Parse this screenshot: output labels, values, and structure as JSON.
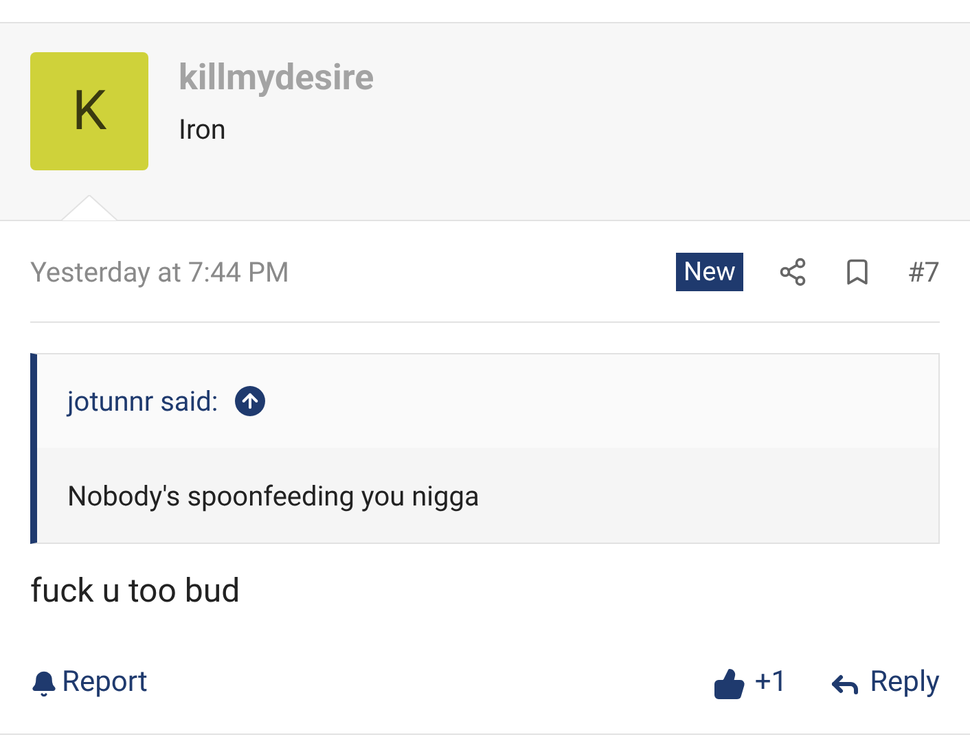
{
  "user": {
    "initial": "K",
    "name": "killmydesire",
    "title": "Iron"
  },
  "post": {
    "date": "Yesterday at 7:44 PM",
    "badge": "New",
    "number": "#7"
  },
  "quote": {
    "author": "jotunnr said:",
    "text": "Nobody's spoonfeeding you nigga"
  },
  "message": "fuck u too bud",
  "actions": {
    "report": "Report",
    "likes": "+1",
    "reply": "Reply"
  }
}
